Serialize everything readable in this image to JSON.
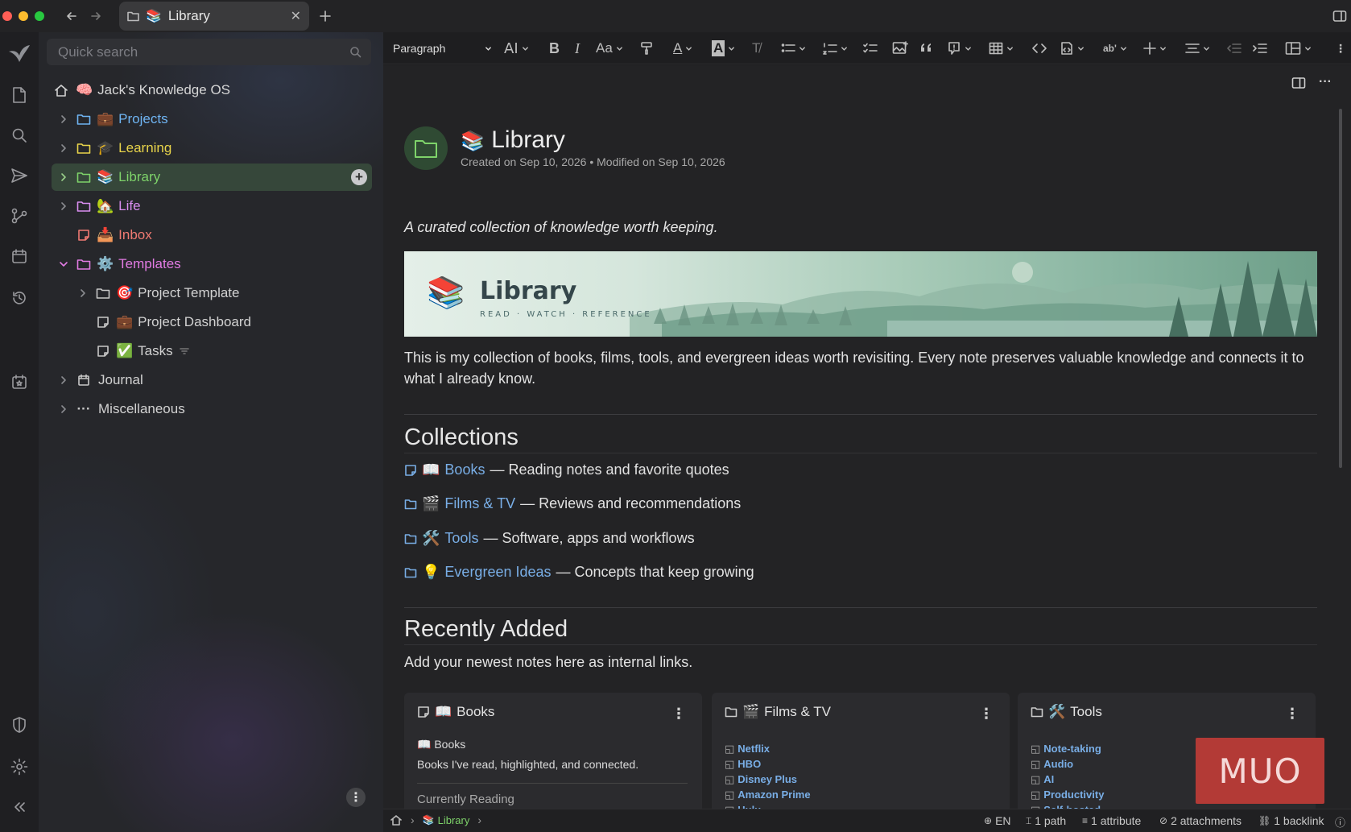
{
  "window": {
    "tab_title": "Library"
  },
  "search": {
    "placeholder": "Quick search"
  },
  "tree": {
    "root": {
      "emoji": "🧠",
      "label": "Jack's Knowledge OS"
    },
    "items": [
      {
        "emoji": "💼",
        "label": "Projects",
        "color": "#6fb4f2"
      },
      {
        "emoji": "🎓",
        "label": "Learning",
        "color": "#e8d44a"
      },
      {
        "emoji": "📚",
        "label": "Library",
        "color": "#7ed36a"
      },
      {
        "emoji": "🏡",
        "label": "Life",
        "color": "#d98ef0"
      },
      {
        "emoji": "📥",
        "label": "Inbox",
        "color": "#f07a72"
      },
      {
        "emoji": "⚙️",
        "label": "Templates",
        "color": "#e27be3"
      },
      {
        "emoji": "🎯",
        "label": "Project Template",
        "color": "#d2d2d2"
      },
      {
        "emoji": "💼",
        "label": "Project Dashboard",
        "color": "#d2d2d2"
      },
      {
        "emoji": "✅",
        "label": "Tasks",
        "color": "#d2d2d2"
      },
      {
        "emoji": "",
        "label": "Journal",
        "color": "#d2d2d2"
      },
      {
        "emoji": "",
        "label": "Miscellaneous",
        "color": "#d2d2d2"
      }
    ]
  },
  "toolbar": {
    "block_type": "Paragraph"
  },
  "note": {
    "title_emoji": "📚",
    "title": "Library",
    "meta": "Created on Sep 10, 2026 • Modified on Sep 10, 2026",
    "intro": "A curated collection of knowledge worth keeping.",
    "banner_title": "Library",
    "banner_subtitle": "READ · WATCH · REFERENCE",
    "description": "This is my collection of books, films, tools, and evergreen ideas worth revisiting. Every note preserves valuable knowledge and connects it to what I already know.",
    "collections_heading": "Collections",
    "collections": [
      {
        "emoji": "📖",
        "link": "Books",
        "desc": "— Reading notes and favorite quotes"
      },
      {
        "emoji": "🎬",
        "link": "Films & TV",
        "desc": "— Reviews and recommendations"
      },
      {
        "emoji": "🛠️",
        "link": "Tools",
        "desc": "— Software, apps and workflows"
      },
      {
        "emoji": "💡",
        "link": "Evergreen Ideas",
        "desc": "— Concepts that keep growing"
      }
    ],
    "recent_heading": "Recently Added",
    "recent_text": "Add your newest notes here as internal links."
  },
  "cards": [
    {
      "emoji": "📖",
      "title": "Books",
      "subtitle_emoji": "📖",
      "subtitle": "Books",
      "text": "Books I've read, highlighted, and connected.",
      "section": "Currently Reading"
    },
    {
      "emoji": "🎬",
      "title": "Films & TV",
      "links": [
        "Netflix",
        "HBO",
        "Disney Plus",
        "Amazon Prime",
        "Hulu"
      ]
    },
    {
      "emoji": "🛠️",
      "title": "Tools",
      "links": [
        "Note-taking",
        "Audio",
        "AI",
        "Productivity",
        "Self-hosted"
      ]
    }
  ],
  "breadcrumb": {
    "current": "Library"
  },
  "status": {
    "language": "EN",
    "paths": "1 path",
    "attributes": "1 attribute",
    "attachments": "2 attachments",
    "backlinks": "1 backlink"
  },
  "watermark": "MUO"
}
